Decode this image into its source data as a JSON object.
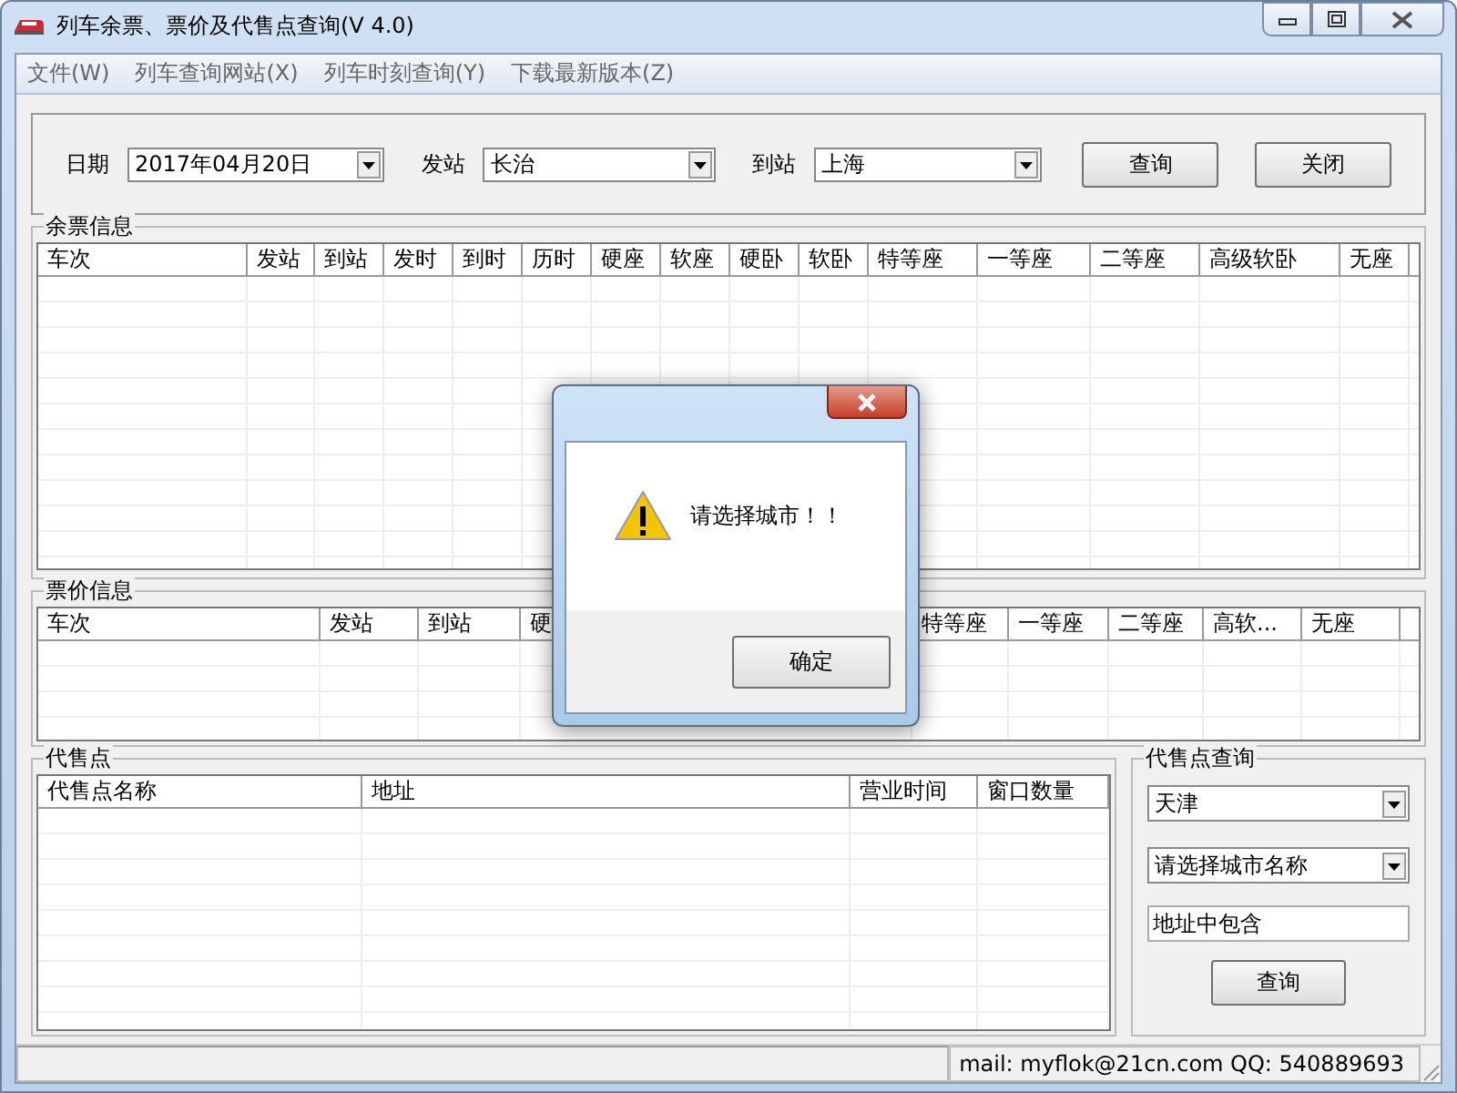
{
  "window": {
    "title": "列车余票、票价及代售点查询(V 4.0)"
  },
  "menu": [
    "文件(W)",
    "列车查询网站(X)",
    "列车时刻查询(Y)",
    "下载最新版本(Z)"
  ],
  "query": {
    "date_label": "日期",
    "date": "2017年04月20日",
    "from_label": "发站",
    "from": "长治",
    "to_label": "到站",
    "to": "上海",
    "buttons": [
      "查询",
      "关闭"
    ]
  },
  "tickets": {
    "title": "余票信息",
    "columns": [
      "车次",
      "发站",
      "到站",
      "发时",
      "到时",
      "历时",
      "硬座",
      "软座",
      "硬卧",
      "软卧",
      "特等座",
      "一等座",
      "二等座",
      "高级软卧",
      "无座"
    ]
  },
  "fares": {
    "title": "票价信息",
    "columns": [
      "车次",
      "发站",
      "到站",
      "硬",
      "特等座",
      "一等座",
      "二等座",
      "高软...",
      "无座"
    ]
  },
  "agencies": {
    "title": "代售点",
    "columns": [
      "代售点名称",
      "地址",
      "营业时间",
      "窗口数量"
    ]
  },
  "agency_search": {
    "title": "代售点查询",
    "province": "天津",
    "city": "请选择城市名称",
    "address": "地址中包含",
    "button": "查询"
  },
  "status_bar": {
    "contact": "mail: myflok@21cn.com  QQ: 540889693"
  },
  "dialog": {
    "message": "请选择城市！！",
    "button": "确定"
  }
}
